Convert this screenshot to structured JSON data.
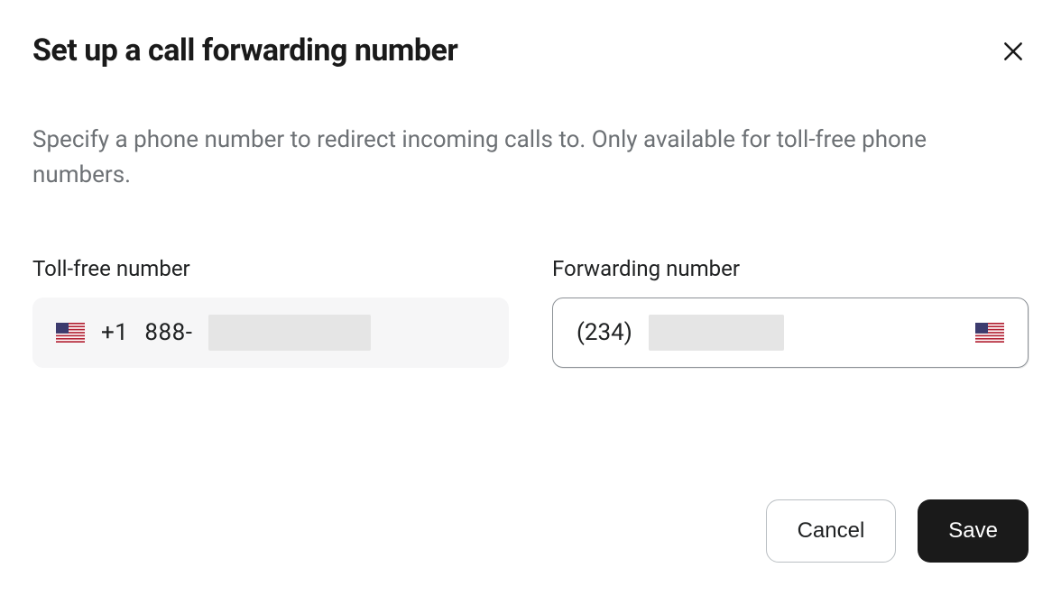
{
  "header": {
    "title": "Set up a call forwarding number"
  },
  "description": "Specify a phone number to redirect incoming calls to. Only available for toll-free phone numbers.",
  "fields": {
    "tollfree": {
      "label": "Toll-free number",
      "prefix": "+1",
      "value_visible": "888-",
      "country_code": "US"
    },
    "forwarding": {
      "label": "Forwarding number",
      "value_visible": "(234)",
      "country_code": "US"
    }
  },
  "footer": {
    "cancel_label": "Cancel",
    "save_label": "Save"
  }
}
